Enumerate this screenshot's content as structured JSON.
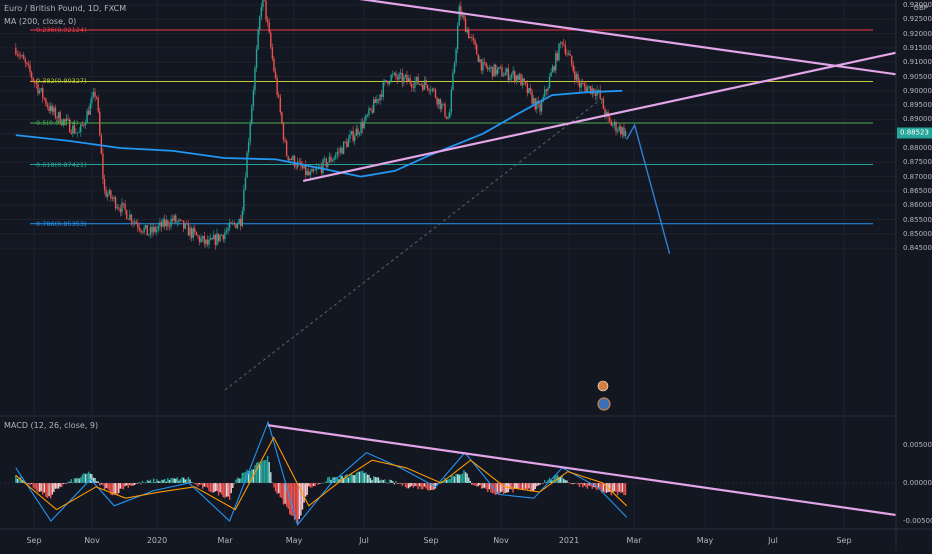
{
  "header": {
    "symbol_title": "Euro / British Pound, 1D, FXCM",
    "ma_label": "MA (200, close, 0)",
    "macd_label": "MACD (12, 26, close, 9)",
    "currency": "GBP"
  },
  "colors": {
    "background": "#131722",
    "up_candle": "#26a69a",
    "down_candle": "#ef5350",
    "ma_line": "#2196f3",
    "trendline": "#e1a5e8",
    "projection": "#2f7fd8"
  },
  "chart_data": [
    {
      "type": "candlestick",
      "title": "Euro / British Pound, 1D, FXCM",
      "x_tick_labels": [
        "Sep",
        "Nov",
        "2020",
        "Mar",
        "May",
        "Jul",
        "Sep",
        "Nov",
        "2021",
        "Mar",
        "May",
        "Jul",
        "Sep"
      ],
      "y_tick_labels": [
        "0.84500",
        "0.85000",
        "0.85500",
        "0.86000",
        "0.86500",
        "0.87000",
        "0.87500",
        "0.88000",
        "0.88500",
        "0.89000",
        "0.89500",
        "0.90000",
        "0.90500",
        "0.91000",
        "0.91500",
        "0.92000",
        "0.92500",
        "0.93000"
      ],
      "ylim": [
        0.843,
        0.935
      ],
      "last_price": "0.88523",
      "fib_levels": [
        {
          "label": "0.236(0.92124)",
          "value": 0.92124,
          "color": "#f23645"
        },
        {
          "label": "0.382(0.90327)",
          "value": 0.90327,
          "color": "#c0ca33"
        },
        {
          "label": "0.5(0.88874)",
          "value": 0.88874,
          "color": "#4caf50"
        },
        {
          "label": "0.618(0.87421)",
          "value": 0.87421,
          "color": "#26a69a"
        },
        {
          "label": "0.786(0.85353)",
          "value": 0.85353,
          "color": "#2196f3"
        }
      ],
      "ma_200": [
        {
          "date": "2019-08-15",
          "value": 0.8845
        },
        {
          "date": "2019-10-01",
          "value": 0.8825
        },
        {
          "date": "2019-11-15",
          "value": 0.88
        },
        {
          "date": "2020-01-01",
          "value": 0.879
        },
        {
          "date": "2020-02-15",
          "value": 0.8765
        },
        {
          "date": "2020-04-01",
          "value": 0.876
        },
        {
          "date": "2020-05-15",
          "value": 0.8725
        },
        {
          "date": "2020-06-15",
          "value": 0.87
        },
        {
          "date": "2020-07-15",
          "value": 0.872
        },
        {
          "date": "2020-08-15",
          "value": 0.8775
        },
        {
          "date": "2020-10-01",
          "value": 0.885
        },
        {
          "date": "2020-11-01",
          "value": 0.892
        },
        {
          "date": "2020-12-01",
          "value": 0.8985
        },
        {
          "date": "2021-01-01",
          "value": 0.8995
        },
        {
          "date": "2021-02-01",
          "value": 0.9
        }
      ],
      "price_path": [
        {
          "date": "2019-08-15",
          "value": 0.915
        },
        {
          "date": "2019-09-15",
          "value": 0.893
        },
        {
          "date": "2019-10-10",
          "value": 0.885
        },
        {
          "date": "2019-10-25",
          "value": 0.9
        },
        {
          "date": "2019-11-01",
          "value": 0.865
        },
        {
          "date": "2019-12-10",
          "value": 0.85
        },
        {
          "date": "2020-01-01",
          "value": 0.855
        },
        {
          "date": "2020-02-01",
          "value": 0.846
        },
        {
          "date": "2020-03-01",
          "value": 0.855
        },
        {
          "date": "2020-03-20",
          "value": 0.935
        },
        {
          "date": "2020-04-10",
          "value": 0.878
        },
        {
          "date": "2020-05-01",
          "value": 0.87
        },
        {
          "date": "2020-05-25",
          "value": 0.878
        },
        {
          "date": "2020-06-20",
          "value": 0.89
        },
        {
          "date": "2020-07-10",
          "value": 0.905
        },
        {
          "date": "2020-08-15",
          "value": 0.902
        },
        {
          "date": "2020-09-01",
          "value": 0.89
        },
        {
          "date": "2020-09-10",
          "value": 0.928
        },
        {
          "date": "2020-10-01",
          "value": 0.908
        },
        {
          "date": "2020-11-01",
          "value": 0.905
        },
        {
          "date": "2020-11-20",
          "value": 0.893
        },
        {
          "date": "2020-12-10",
          "value": 0.918
        },
        {
          "date": "2020-12-25",
          "value": 0.902
        },
        {
          "date": "2021-01-10",
          "value": 0.9
        },
        {
          "date": "2021-01-20",
          "value": 0.889
        },
        {
          "date": "2021-02-05",
          "value": 0.8852
        }
      ],
      "projection": [
        {
          "date": "2021-02-05",
          "value": 0.883
        },
        {
          "date": "2021-02-12",
          "value": 0.888
        },
        {
          "date": "2021-03-15",
          "value": 0.843
        }
      ],
      "trendlines": [
        {
          "name": "upper",
          "from": {
            "date": "2020-04-05",
            "value": 0.936
          },
          "to": {
            "date": "2021-10-15",
            "value": 0.905
          }
        },
        {
          "name": "lower",
          "from": {
            "date": "2020-04-25",
            "value": 0.8685
          },
          "to": {
            "date": "2021-10-15",
            "value": 0.9145
          }
        }
      ]
    },
    {
      "type": "histogram",
      "title": "MACD (12, 26, close, 9)",
      "y_tick_labels": [
        "0.00500",
        "0.00000",
        "-0.00500"
      ],
      "ylim": [
        -0.0068,
        0.0068
      ],
      "macd_line": [
        {
          "date": "2019-08-15",
          "value": 0.002
        },
        {
          "date": "2019-09-15",
          "value": -0.005
        },
        {
          "date": "2019-10-20",
          "value": 0.0005
        },
        {
          "date": "2019-11-10",
          "value": -0.003
        },
        {
          "date": "2019-12-15",
          "value": -0.001
        },
        {
          "date": "2020-01-15",
          "value": 0.0
        },
        {
          "date": "2020-02-20",
          "value": -0.005
        },
        {
          "date": "2020-03-25",
          "value": 0.008
        },
        {
          "date": "2020-04-20",
          "value": -0.0055
        },
        {
          "date": "2020-05-20",
          "value": 0.0
        },
        {
          "date": "2020-06-20",
          "value": 0.004
        },
        {
          "date": "2020-07-20",
          "value": 0.002
        },
        {
          "date": "2020-08-20",
          "value": -0.0005
        },
        {
          "date": "2020-09-15",
          "value": 0.004
        },
        {
          "date": "2020-10-15",
          "value": -0.0015
        },
        {
          "date": "2020-11-15",
          "value": -0.002
        },
        {
          "date": "2020-12-10",
          "value": 0.002
        },
        {
          "date": "2021-01-10",
          "value": -0.0005
        },
        {
          "date": "2021-02-05",
          "value": -0.0045
        }
      ],
      "signal_line": [
        {
          "date": "2019-08-15",
          "value": 0.001
        },
        {
          "date": "2019-09-20",
          "value": -0.0035
        },
        {
          "date": "2019-10-25",
          "value": -0.0005
        },
        {
          "date": "2019-11-20",
          "value": -0.002
        },
        {
          "date": "2019-12-20",
          "value": -0.0012
        },
        {
          "date": "2020-01-20",
          "value": -0.0005
        },
        {
          "date": "2020-02-25",
          "value": -0.0035
        },
        {
          "date": "2020-03-30",
          "value": 0.006
        },
        {
          "date": "2020-04-30",
          "value": -0.003
        },
        {
          "date": "2020-05-30",
          "value": 0.0005
        },
        {
          "date": "2020-06-25",
          "value": 0.003
        },
        {
          "date": "2020-07-25",
          "value": 0.002
        },
        {
          "date": "2020-08-25",
          "value": 0.0
        },
        {
          "date": "2020-09-20",
          "value": 0.003
        },
        {
          "date": "2020-10-20",
          "value": -0.0005
        },
        {
          "date": "2020-11-20",
          "value": -0.0012
        },
        {
          "date": "2020-12-15",
          "value": 0.0015
        },
        {
          "date": "2021-01-15",
          "value": 0.0
        },
        {
          "date": "2021-02-05",
          "value": -0.003
        }
      ],
      "trendline": {
        "from": {
          "date": "2020-03-25",
          "value": 0.0076
        },
        "to": {
          "date": "2021-10-15",
          "value": -0.0045
        }
      }
    }
  ]
}
